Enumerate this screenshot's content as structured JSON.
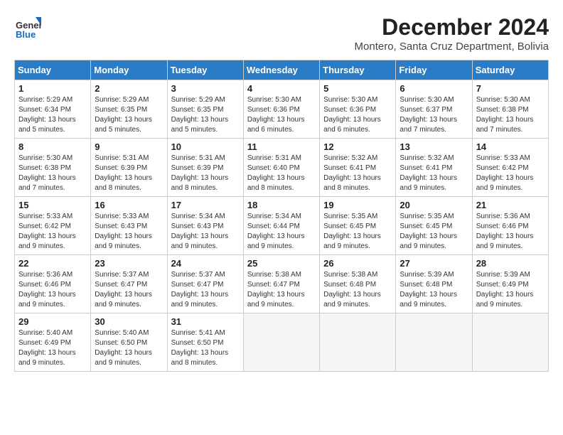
{
  "logo": {
    "line1": "General",
    "line2": "Blue"
  },
  "title": "December 2024",
  "subtitle": "Montero, Santa Cruz Department, Bolivia",
  "days_header": [
    "Sunday",
    "Monday",
    "Tuesday",
    "Wednesday",
    "Thursday",
    "Friday",
    "Saturday"
  ],
  "weeks": [
    [
      {
        "day": "1",
        "sunrise": "5:29 AM",
        "sunset": "6:34 PM",
        "daylight": "13 hours and 5 minutes."
      },
      {
        "day": "2",
        "sunrise": "5:29 AM",
        "sunset": "6:35 PM",
        "daylight": "13 hours and 5 minutes."
      },
      {
        "day": "3",
        "sunrise": "5:29 AM",
        "sunset": "6:35 PM",
        "daylight": "13 hours and 5 minutes."
      },
      {
        "day": "4",
        "sunrise": "5:30 AM",
        "sunset": "6:36 PM",
        "daylight": "13 hours and 6 minutes."
      },
      {
        "day": "5",
        "sunrise": "5:30 AM",
        "sunset": "6:36 PM",
        "daylight": "13 hours and 6 minutes."
      },
      {
        "day": "6",
        "sunrise": "5:30 AM",
        "sunset": "6:37 PM",
        "daylight": "13 hours and 7 minutes."
      },
      {
        "day": "7",
        "sunrise": "5:30 AM",
        "sunset": "6:38 PM",
        "daylight": "13 hours and 7 minutes."
      }
    ],
    [
      {
        "day": "8",
        "sunrise": "5:30 AM",
        "sunset": "6:38 PM",
        "daylight": "13 hours and 7 minutes."
      },
      {
        "day": "9",
        "sunrise": "5:31 AM",
        "sunset": "6:39 PM",
        "daylight": "13 hours and 8 minutes."
      },
      {
        "day": "10",
        "sunrise": "5:31 AM",
        "sunset": "6:39 PM",
        "daylight": "13 hours and 8 minutes."
      },
      {
        "day": "11",
        "sunrise": "5:31 AM",
        "sunset": "6:40 PM",
        "daylight": "13 hours and 8 minutes."
      },
      {
        "day": "12",
        "sunrise": "5:32 AM",
        "sunset": "6:41 PM",
        "daylight": "13 hours and 8 minutes."
      },
      {
        "day": "13",
        "sunrise": "5:32 AM",
        "sunset": "6:41 PM",
        "daylight": "13 hours and 9 minutes."
      },
      {
        "day": "14",
        "sunrise": "5:33 AM",
        "sunset": "6:42 PM",
        "daylight": "13 hours and 9 minutes."
      }
    ],
    [
      {
        "day": "15",
        "sunrise": "5:33 AM",
        "sunset": "6:42 PM",
        "daylight": "13 hours and 9 minutes."
      },
      {
        "day": "16",
        "sunrise": "5:33 AM",
        "sunset": "6:43 PM",
        "daylight": "13 hours and 9 minutes."
      },
      {
        "day": "17",
        "sunrise": "5:34 AM",
        "sunset": "6:43 PM",
        "daylight": "13 hours and 9 minutes."
      },
      {
        "day": "18",
        "sunrise": "5:34 AM",
        "sunset": "6:44 PM",
        "daylight": "13 hours and 9 minutes."
      },
      {
        "day": "19",
        "sunrise": "5:35 AM",
        "sunset": "6:45 PM",
        "daylight": "13 hours and 9 minutes."
      },
      {
        "day": "20",
        "sunrise": "5:35 AM",
        "sunset": "6:45 PM",
        "daylight": "13 hours and 9 minutes."
      },
      {
        "day": "21",
        "sunrise": "5:36 AM",
        "sunset": "6:46 PM",
        "daylight": "13 hours and 9 minutes."
      }
    ],
    [
      {
        "day": "22",
        "sunrise": "5:36 AM",
        "sunset": "6:46 PM",
        "daylight": "13 hours and 9 minutes."
      },
      {
        "day": "23",
        "sunrise": "5:37 AM",
        "sunset": "6:47 PM",
        "daylight": "13 hours and 9 minutes."
      },
      {
        "day": "24",
        "sunrise": "5:37 AM",
        "sunset": "6:47 PM",
        "daylight": "13 hours and 9 minutes."
      },
      {
        "day": "25",
        "sunrise": "5:38 AM",
        "sunset": "6:47 PM",
        "daylight": "13 hours and 9 minutes."
      },
      {
        "day": "26",
        "sunrise": "5:38 AM",
        "sunset": "6:48 PM",
        "daylight": "13 hours and 9 minutes."
      },
      {
        "day": "27",
        "sunrise": "5:39 AM",
        "sunset": "6:48 PM",
        "daylight": "13 hours and 9 minutes."
      },
      {
        "day": "28",
        "sunrise": "5:39 AM",
        "sunset": "6:49 PM",
        "daylight": "13 hours and 9 minutes."
      }
    ],
    [
      {
        "day": "29",
        "sunrise": "5:40 AM",
        "sunset": "6:49 PM",
        "daylight": "13 hours and 9 minutes."
      },
      {
        "day": "30",
        "sunrise": "5:40 AM",
        "sunset": "6:50 PM",
        "daylight": "13 hours and 9 minutes."
      },
      {
        "day": "31",
        "sunrise": "5:41 AM",
        "sunset": "6:50 PM",
        "daylight": "13 hours and 8 minutes."
      },
      null,
      null,
      null,
      null
    ]
  ]
}
